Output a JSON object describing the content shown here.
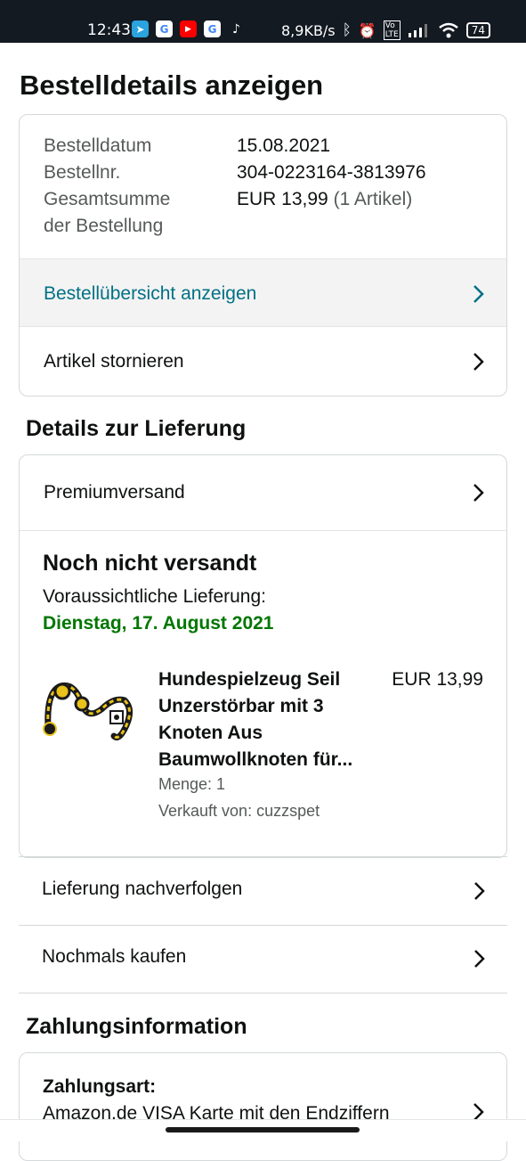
{
  "status_bar": {
    "time": "12:43",
    "net_speed": "8,9KB/s",
    "battery": "74",
    "app_icons": [
      "telegram-icon",
      "google-icon",
      "youtube-icon",
      "google-icon",
      "tiktok-icon"
    ]
  },
  "page_title": "Bestelldetails anzeigen",
  "order_summary": {
    "date_label": "Bestelldatum",
    "date_value": "15.08.2021",
    "number_label": "Bestellnr.",
    "number_value": "304-0223164-3813976",
    "total_label_line1": "Gesamtsumme",
    "total_label_line2": "der Bestellung",
    "total_value": "EUR 13,99",
    "total_items": "(1 Artikel)",
    "overview_link": "Bestellübersicht anzeigen",
    "cancel_link": "Artikel stornieren"
  },
  "delivery": {
    "section_title": "Details zur Lieferung",
    "shipping_method": "Premiumversand",
    "status_title": "Noch nicht versandt",
    "expected_label": "Voraussichtliche Lieferung:",
    "expected_date": "Dienstag, 17. August 2021",
    "item": {
      "title_lines": [
        "Hundespielzeug Seil",
        "Unzerstörbar mit 3",
        "Knoten Aus",
        "Baumwollknoten für..."
      ],
      "price": "EUR 13,99",
      "quantity": "Menge: 1",
      "seller": "Verkauft von: cuzzspet"
    },
    "track_link": "Lieferung nachverfolgen",
    "buy_again_link": "Nochmals kaufen"
  },
  "payment": {
    "section_title": "Zahlungsinformation",
    "method_label": "Zahlungsart:",
    "method_value": "Amazon.de VISA Karte mit den Endziffern"
  },
  "colors": {
    "link_teal": "#007185",
    "delivery_green": "#007600",
    "status_bar_bg": "#131a22"
  }
}
